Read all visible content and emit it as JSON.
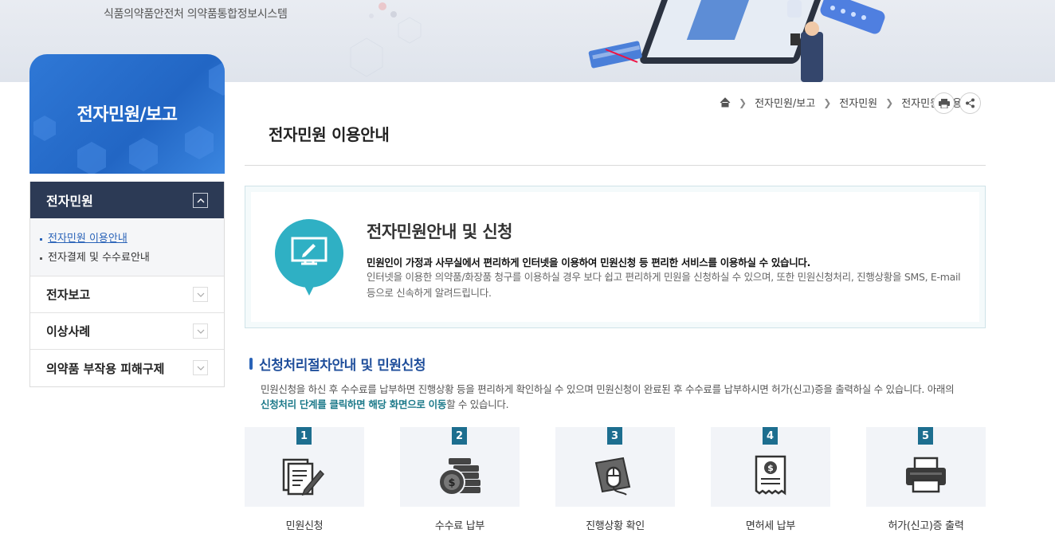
{
  "banner": {
    "subtitle": "식품의약품안전처 의약품통합정보시스템"
  },
  "sidebar": {
    "hero_title": "전자민원/보고",
    "menus": [
      {
        "label": "전자민원",
        "expanded": true,
        "sub": [
          {
            "label": "전자민원 이용안내",
            "active": true
          },
          {
            "label": "전자결제 및 수수료안내",
            "active": false
          }
        ]
      },
      {
        "label": "전자보고",
        "expanded": false
      },
      {
        "label": "이상사례",
        "expanded": false
      },
      {
        "label": "의약품 부작용 피해구제",
        "expanded": false
      }
    ]
  },
  "breadcrumb": {
    "items": [
      "전자민원/보고",
      "전자민원",
      "전자민원 이용안내"
    ],
    "home_icon": "home-icon"
  },
  "page": {
    "title": "전자민원 이용안내"
  },
  "info": {
    "title": "전자민원안내 및 신청",
    "bold_text": "민원인이 가정과 사무실에서 편리하게 인터넷을 이용하여 민원신청 등 편리한 서비스를 이용하실 수 있습니다.",
    "text": "인터넷을 이용한 의약품/화장품 청구를 이용하실 경우 보다 쉽고 편리하게 민원을 신청하실 수 있으며, 또한 민원신청처리, 진행상황을 SMS, E-mail 등으로 신속하게 알려드립니다."
  },
  "section": {
    "title": "신청처리절차안내 및 민원신청",
    "desc_1": "민원신청을 하신 후 수수료를 납부하면 진행상황 등을 편리하게 확인하실 수 있으며 민원신청이 완료된 후 수수료를 납부하시면 허가(신고)증을 출력하실 수 있습니다. 아래의",
    "desc_bold": "신청처리 단계를 클릭하면 해당 화면으로 이동",
    "desc_2": "할 수 있습니다."
  },
  "steps": [
    {
      "num": "1",
      "label": "민원신청",
      "icon": "document-pen-icon"
    },
    {
      "num": "2",
      "label": "수수료 납부",
      "icon": "coins-icon"
    },
    {
      "num": "3",
      "label": "진행상황 확인",
      "icon": "mouse-icon"
    },
    {
      "num": "4",
      "label": "면허세 납부",
      "icon": "receipt-icon"
    },
    {
      "num": "5",
      "label": "허가(신고)증 출력",
      "icon": "printer-icon"
    }
  ],
  "colors": {
    "sidebar_blue": "#2a6fd0",
    "menu_dark": "#2c3a55",
    "accent_teal": "#1d6e8f",
    "section_blue": "#1f4e9b"
  }
}
